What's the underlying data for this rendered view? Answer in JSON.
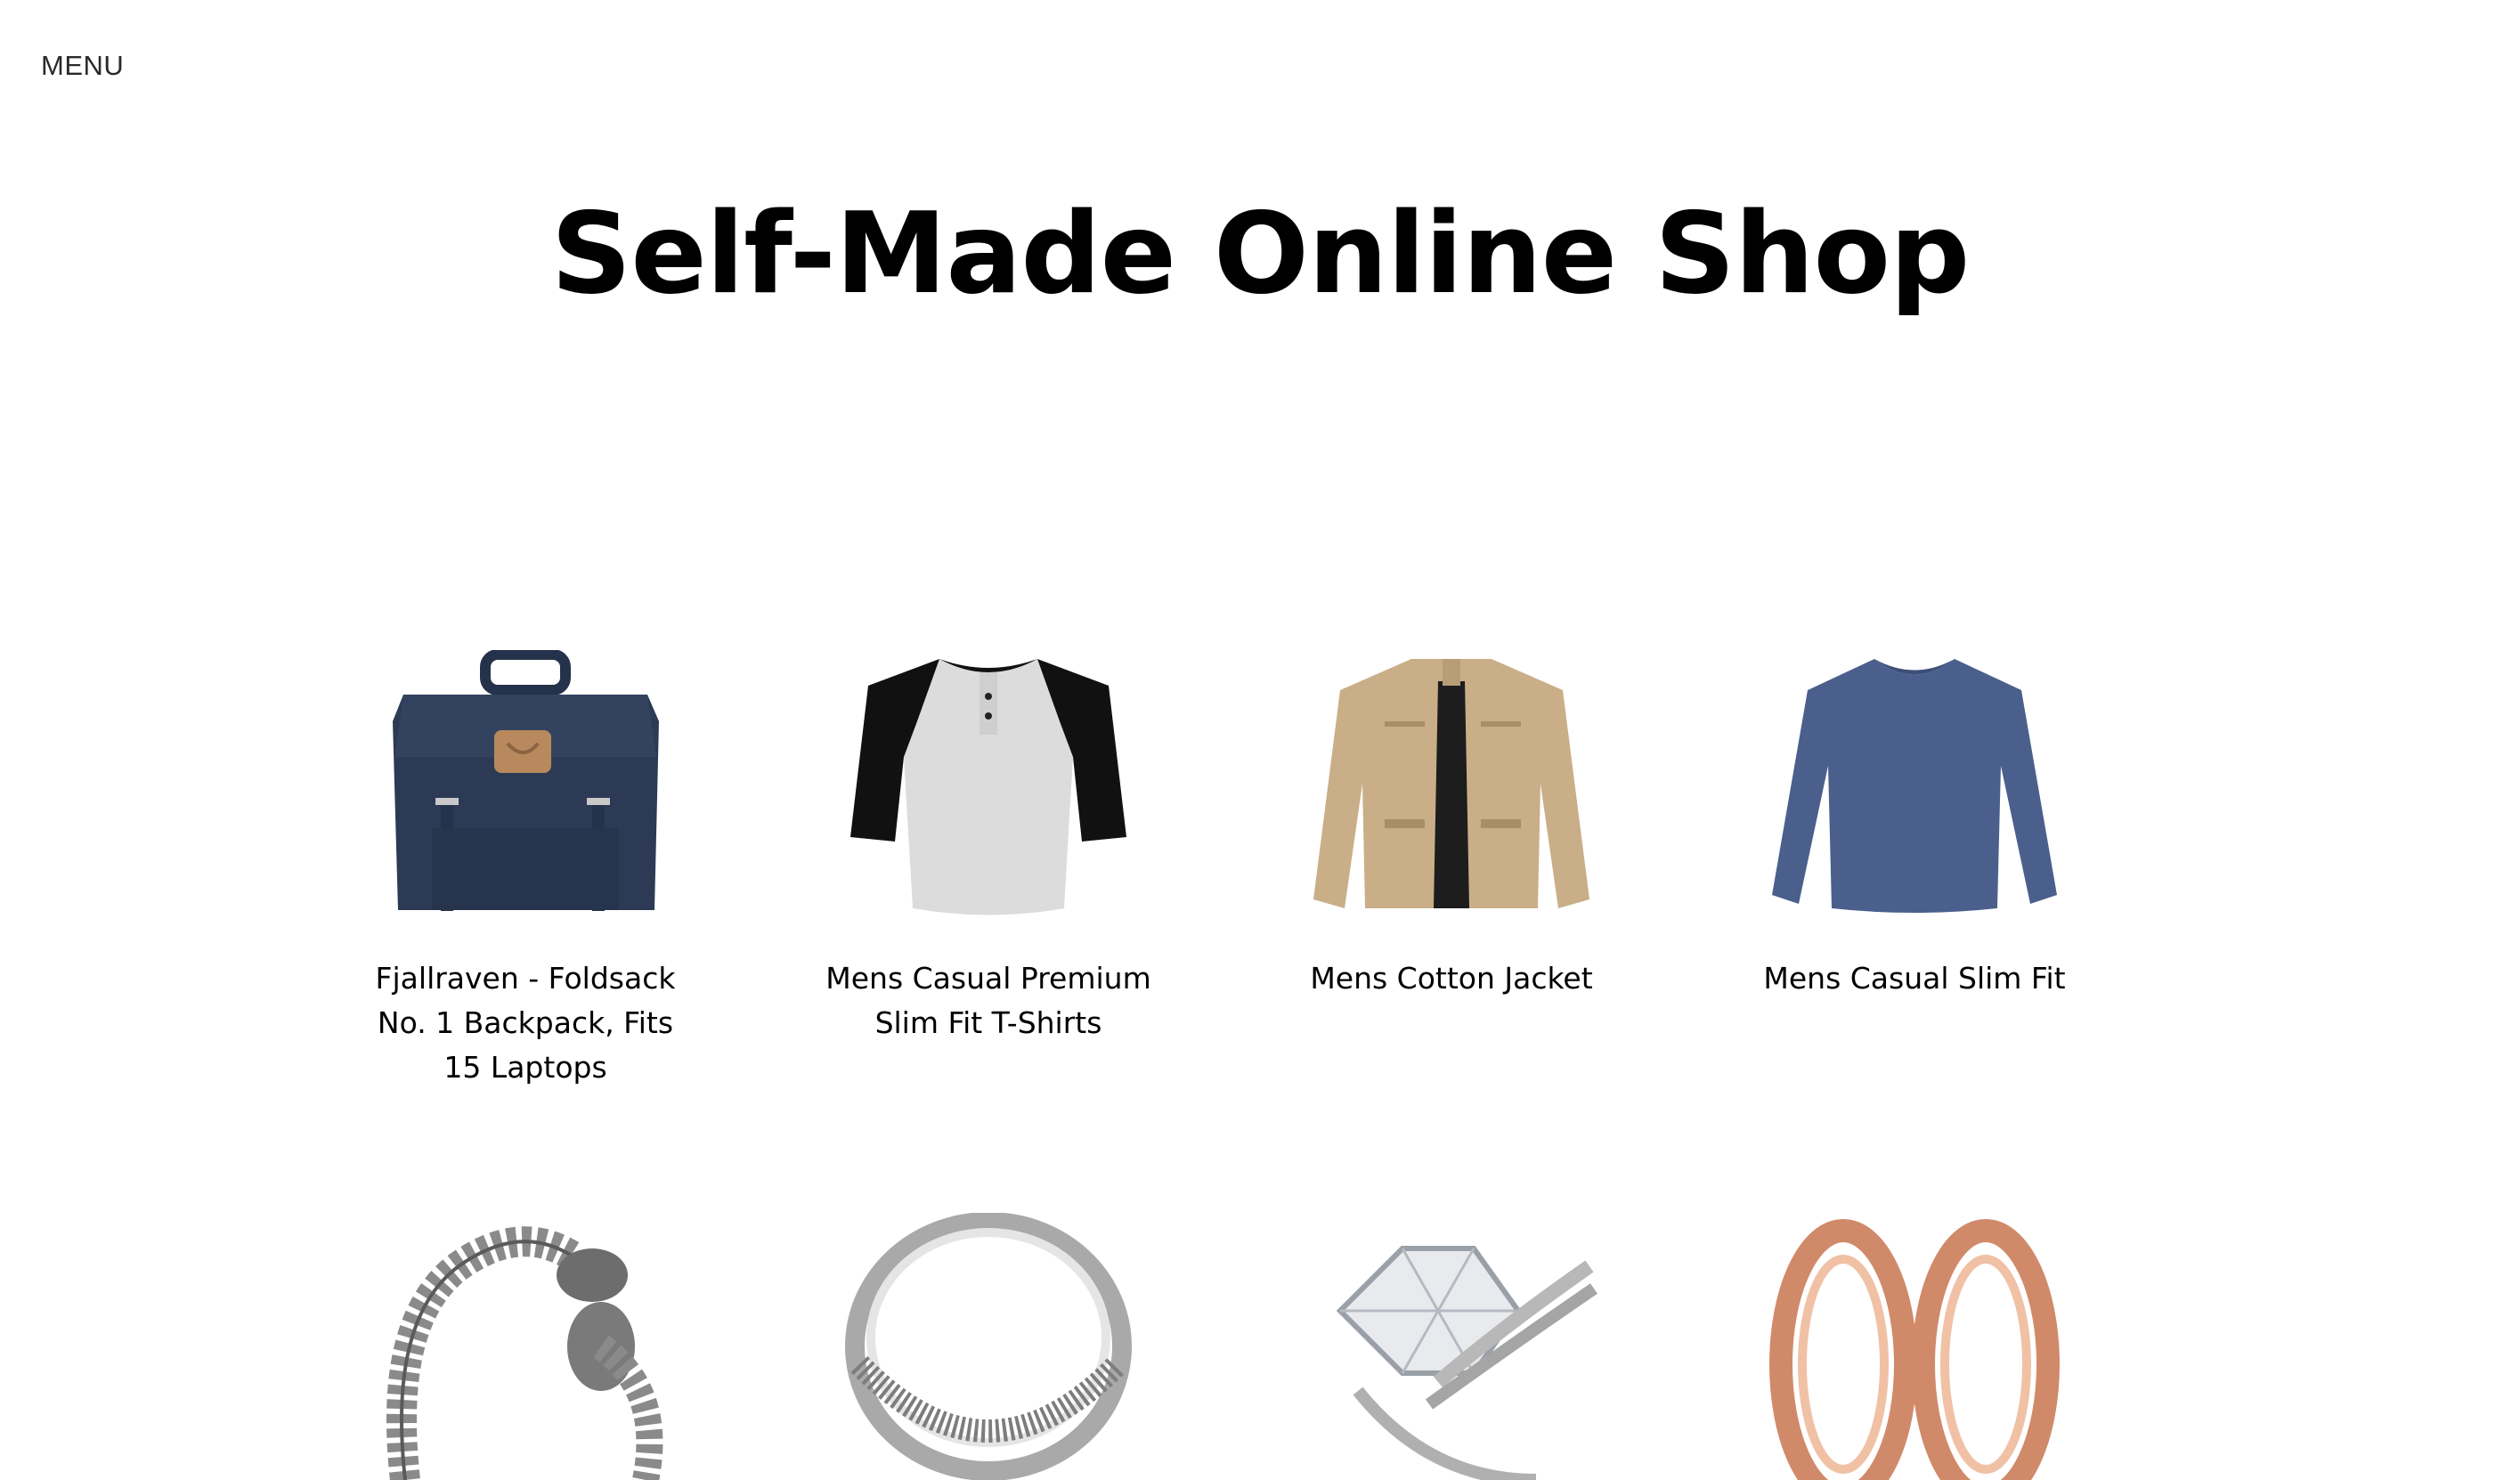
{
  "menu": {
    "label": "MENU"
  },
  "header": {
    "title": "Self-Made Online Shop"
  },
  "products": [
    {
      "name": "Fjallraven - Foldsack No. 1 Backpack, Fits 15 Laptops",
      "icon": "backpack-image"
    },
    {
      "name": "Mens Casual Premium Slim Fit T-Shirts",
      "icon": "raglan-tshirt-image"
    },
    {
      "name": "Mens Cotton Jacket",
      "icon": "jacket-image"
    },
    {
      "name": "Mens Casual Slim Fit",
      "icon": "longsleeve-shirt-image"
    },
    {
      "name": "",
      "icon": "dragon-bracelet-image"
    },
    {
      "name": "",
      "icon": "silver-ring-image"
    },
    {
      "name": "",
      "icon": "diamond-ring-image"
    },
    {
      "name": "",
      "icon": "rose-gold-tunnel-image"
    }
  ],
  "colors": {
    "backpack": "#2c3a55",
    "jacket": "#c9ae88",
    "shirt": "#4a5f8c",
    "rosegold": "#d08a6a"
  }
}
